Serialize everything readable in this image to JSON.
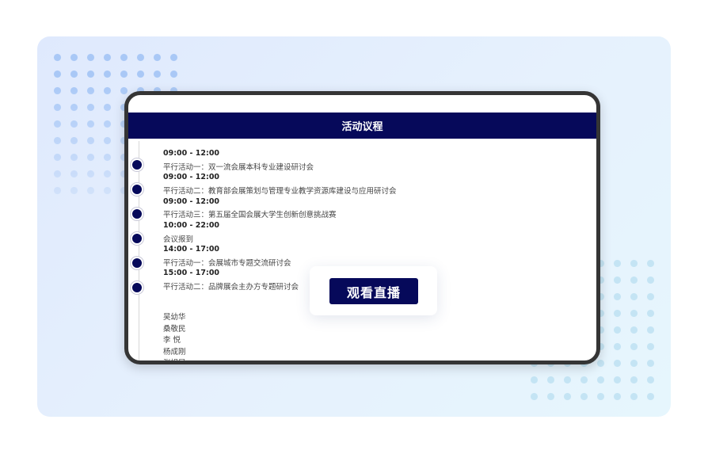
{
  "agenda_panel": {
    "title": "活动议程",
    "items": [
      {
        "time": "09:00 - 12:00",
        "title": "平行活动一：双一流会展本科专业建设研讨会"
      },
      {
        "time": "09:00 - 12:00",
        "title": "平行活动二：教育部会展策划与管理专业教学资源库建设与应用研讨会"
      },
      {
        "time": "09:00 - 12:00",
        "title": "平行活动三：第五届全国会展大学生创新创意挑战赛"
      },
      {
        "time": "10:00 - 22:00",
        "title": "会议报到"
      },
      {
        "time": "14:00 - 17:00",
        "title": "平行活动一：会展城市专题交流研讨会"
      },
      {
        "time": "15:00 - 17:00",
        "title": "平行活动二：品牌展会主办方专题研讨会"
      }
    ],
    "names": [
      "吴幼华",
      "桑敬民",
      "李 悦",
      "杨成刚",
      "张娟凤"
    ]
  },
  "live_button": {
    "label": "观看直播"
  },
  "colors": {
    "accent": "#06095a",
    "device_border": "#353535"
  }
}
